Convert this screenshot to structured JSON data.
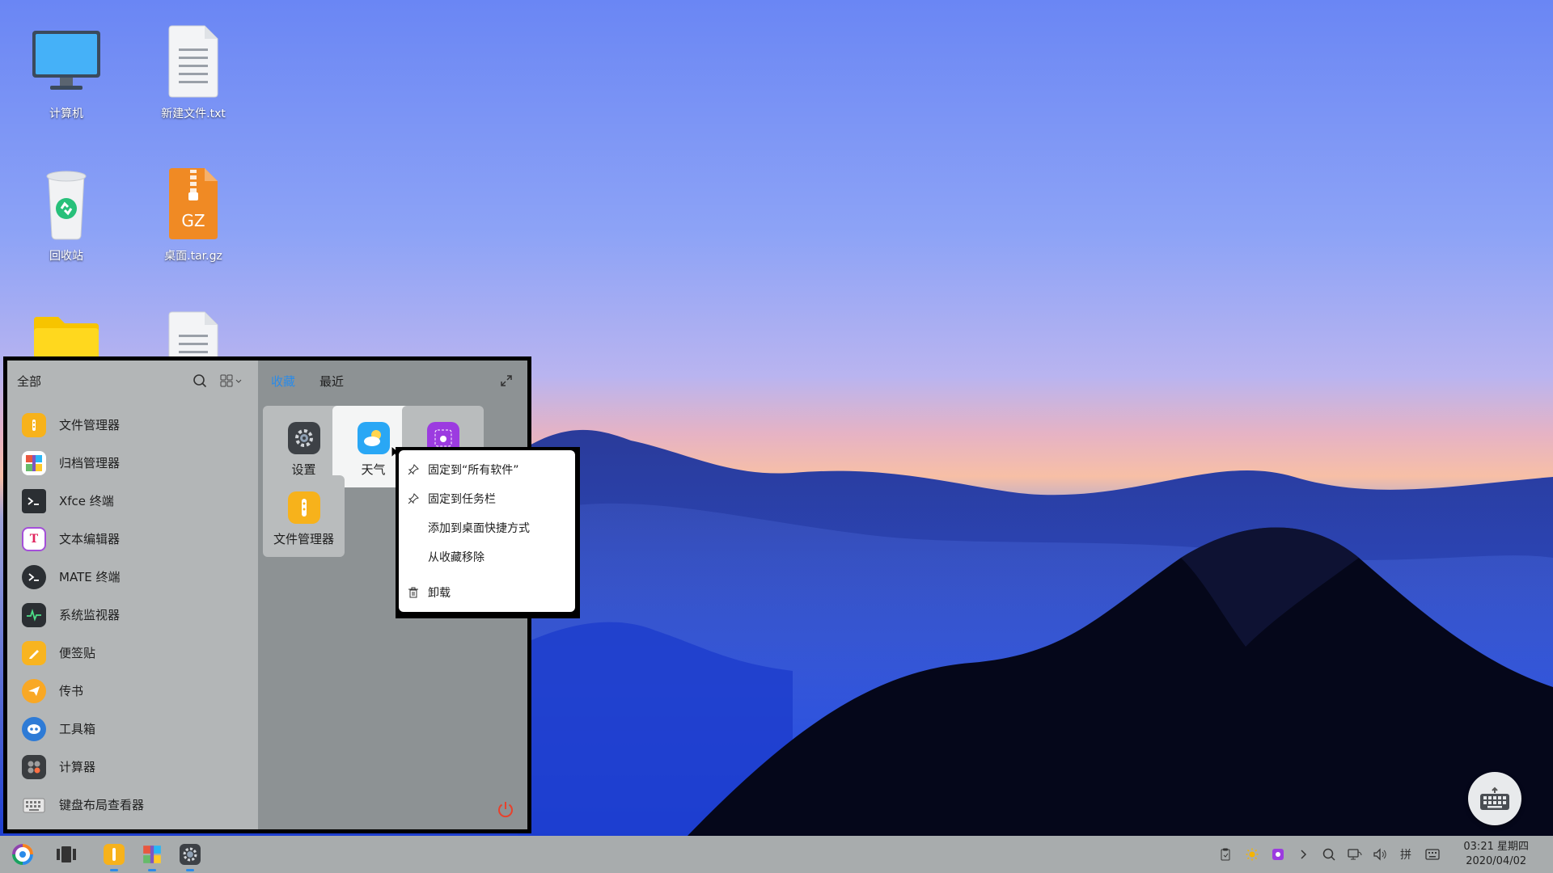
{
  "desktop": {
    "icons": [
      {
        "label": "计算机",
        "icon": "monitor-icon"
      },
      {
        "label": "新建文件.txt",
        "icon": "text-file-icon"
      },
      {
        "label": "回收站",
        "icon": "recycle-bin-icon"
      },
      {
        "label": "桌面.tar.gz",
        "icon": "archive-icon",
        "badge": "GZ"
      },
      {
        "label": "",
        "icon": "folder-icon"
      },
      {
        "label": "",
        "icon": "text-file-icon"
      }
    ]
  },
  "start_menu": {
    "category": "全部",
    "apps": [
      {
        "name": "文件管理器",
        "icon": "file-manager-icon",
        "color": "#f7b21b"
      },
      {
        "name": "归档管理器",
        "icon": "archive-manager-icon",
        "color": "#e9573f"
      },
      {
        "name": "Xfce 终端",
        "icon": "terminal-icon",
        "color": "#2b2f33"
      },
      {
        "name": "文本编辑器",
        "icon": "text-editor-icon",
        "color": "#ffffff"
      },
      {
        "name": "MATE 终端",
        "icon": "terminal-icon",
        "color": "#2b2f33"
      },
      {
        "name": "系统监视器",
        "icon": "system-monitor-icon",
        "color": "#2b2f33"
      },
      {
        "name": "便签贴",
        "icon": "sticky-note-icon",
        "color": "#f8b420"
      },
      {
        "name": "传书",
        "icon": "send-icon",
        "color": "#f9a825"
      },
      {
        "name": "工具箱",
        "icon": "toolbox-icon",
        "color": "#2e7bd6"
      },
      {
        "name": "计算器",
        "icon": "calculator-icon",
        "color": "#3a3d40"
      },
      {
        "name": "键盘布局查看器",
        "icon": "keyboard-icon",
        "color": "#dcdcdc"
      }
    ],
    "tabs": [
      {
        "label": "收藏",
        "active": true
      },
      {
        "label": "最近",
        "active": false
      }
    ],
    "favorites": [
      {
        "label": "设置",
        "icon": "settings-icon"
      },
      {
        "label": "天气",
        "icon": "weather-icon"
      },
      {
        "label": "",
        "icon": "screenshot-icon"
      },
      {
        "label": "文件管理器",
        "icon": "file-manager-icon"
      }
    ]
  },
  "context_menu": {
    "items": [
      {
        "label": "固定到“所有软件”",
        "icon": "pin-icon"
      },
      {
        "label": "固定到任务栏",
        "icon": "pin-icon"
      },
      {
        "label": "添加到桌面快捷方式",
        "icon": ""
      },
      {
        "label": "从收藏移除",
        "icon": ""
      },
      {
        "label": "卸载",
        "icon": "trash-icon"
      }
    ]
  },
  "taskbar": {
    "apps": [
      {
        "name": "开始菜单",
        "icon": "start-menu-icon"
      },
      {
        "name": "多任务视图",
        "icon": "multitask-view-icon"
      },
      {
        "name": "文件管理器",
        "icon": "file-manager-icon",
        "running": true
      },
      {
        "name": "归档管理器",
        "icon": "archive-manager-icon",
        "running": true
      },
      {
        "name": "设置",
        "icon": "settings-icon",
        "running": true
      }
    ],
    "tray": {
      "input_method": "拼"
    },
    "clock": {
      "time": "03:21 星期四",
      "date": "2020/04/02"
    }
  }
}
